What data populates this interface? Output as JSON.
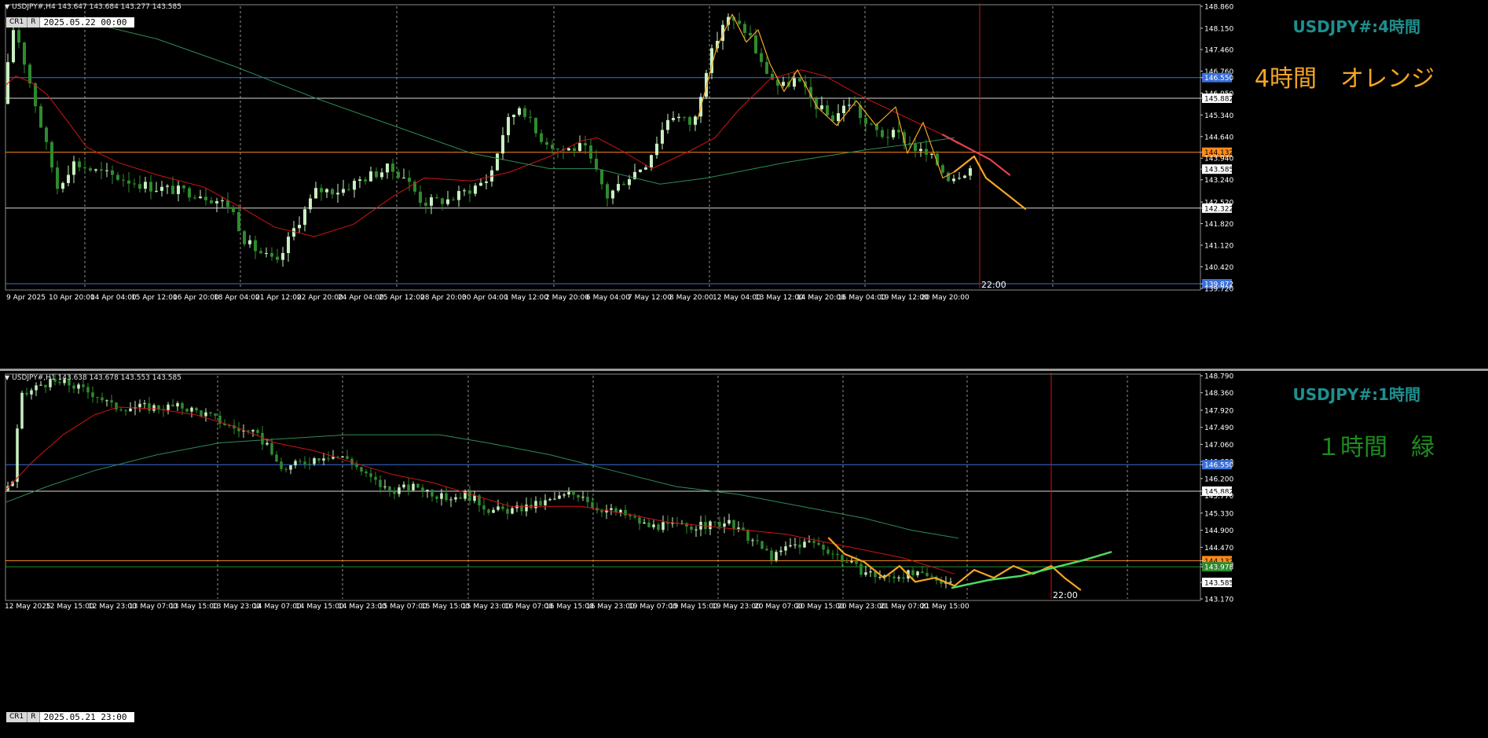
{
  "colors": {
    "background": "#000000",
    "bull": "#c8f0c0",
    "bear": "#2e8b2e",
    "ma_red": "#d01414",
    "ma_green": "#2e8b57",
    "zigzag_orange": "#f5a623",
    "h1_green_line": "#4cd964",
    "grid": "#b4b4b4",
    "hline_blue": "#3a6fd8",
    "hline_white": "#d8d8d8",
    "hline_orange": "#ff8c1a",
    "hline_green": "#2e8b2e",
    "vline_red": "#c81414",
    "title_teal": "#1e8f8f",
    "label_orange": "#f5a623",
    "label_green": "#1e8c1e"
  },
  "h4": {
    "header": "USDJPY#,H4  143.647 143.684 143.277 143.585",
    "period_buttons": [
      "CR1",
      "R"
    ],
    "date_box": "2025.05.22 00:00",
    "chart_title": "USDJPY#:4時間",
    "color_label": "4時間　オレンジ",
    "time_marker": "22:00",
    "price_labels": [
      {
        "text": "148.860",
        "kind": "plain"
      },
      {
        "text": "148.150",
        "kind": "plain"
      },
      {
        "text": "147.460",
        "kind": "plain"
      },
      {
        "text": "146.760",
        "kind": "plain"
      },
      {
        "text": "146.550",
        "kind": "blue"
      },
      {
        "text": "146.050",
        "kind": "plain"
      },
      {
        "text": "145.882",
        "kind": "white"
      },
      {
        "text": "145.340",
        "kind": "plain"
      },
      {
        "text": "144.640",
        "kind": "plain"
      },
      {
        "text": "144.132",
        "kind": "orange"
      },
      {
        "text": "143.940",
        "kind": "plain"
      },
      {
        "text": "143.585",
        "kind": "white"
      },
      {
        "text": "143.240",
        "kind": "plain"
      },
      {
        "text": "142.520",
        "kind": "plain"
      },
      {
        "text": "142.322",
        "kind": "white"
      },
      {
        "text": "141.820",
        "kind": "plain"
      },
      {
        "text": "141.120",
        "kind": "plain"
      },
      {
        "text": "140.420",
        "kind": "plain"
      },
      {
        "text": "139.872",
        "kind": "blue"
      },
      {
        "text": "139.720",
        "kind": "plain"
      }
    ],
    "time_labels": [
      "9 Apr 2025",
      "10 Apr 20:00",
      "14 Apr 04:00",
      "15 Apr 12:00",
      "16 Apr 20:00",
      "18 Apr 04:00",
      "21 Apr 12:00",
      "22 Apr 20:00",
      "24 Apr 04:00",
      "25 Apr 12:00",
      "28 Apr 20:00",
      "30 Apr 04:00",
      "1 May 12:00",
      "2 May 20:00",
      "6 May 04:00",
      "7 May 12:00",
      "8 May 20:00",
      "12 May 04:00",
      "13 May 12:00",
      "14 May 20:00",
      "16 May 04:00",
      "19 May 12:00",
      "20 May 20:00"
    ]
  },
  "h1": {
    "header": "USDJPY#,H1  143.638 143.678 143.553 143.585",
    "period_buttons": [
      "CR1",
      "R"
    ],
    "date_box": "2025.05.21 23:00",
    "chart_title": "USDJPY#:1時間",
    "color_label": "１時間　緑",
    "time_marker": "22:00",
    "price_labels": [
      {
        "text": "148.790",
        "kind": "plain"
      },
      {
        "text": "148.360",
        "kind": "plain"
      },
      {
        "text": "147.920",
        "kind": "plain"
      },
      {
        "text": "147.490",
        "kind": "plain"
      },
      {
        "text": "147.060",
        "kind": "plain"
      },
      {
        "text": "146.630",
        "kind": "plain"
      },
      {
        "text": "146.550",
        "kind": "blue"
      },
      {
        "text": "146.200",
        "kind": "plain"
      },
      {
        "text": "145.882",
        "kind": "white"
      },
      {
        "text": "145.770",
        "kind": "plain"
      },
      {
        "text": "145.330",
        "kind": "plain"
      },
      {
        "text": "144.900",
        "kind": "plain"
      },
      {
        "text": "144.470",
        "kind": "plain"
      },
      {
        "text": "144.132",
        "kind": "orange"
      },
      {
        "text": "144.040",
        "kind": "plain"
      },
      {
        "text": "143.978",
        "kind": "green"
      },
      {
        "text": "143.585",
        "kind": "white"
      },
      {
        "text": "143.170",
        "kind": "plain"
      }
    ],
    "time_labels": [
      "12 May 2025",
      "12 May 15:00",
      "12 May 23:00",
      "13 May 07:00",
      "13 May 15:00",
      "13 May 23:00",
      "14 May 07:00",
      "14 May 15:00",
      "14 May 23:00",
      "15 May 07:00",
      "15 May 15:00",
      "15 May 23:00",
      "16 May 07:00",
      "16 May 15:00",
      "16 May 23:00",
      "19 May 07:00",
      "19 May 15:00",
      "19 May 23:00",
      "20 May 07:00",
      "20 May 15:00",
      "20 May 23:00",
      "21 May 07:00",
      "21 May 15:00"
    ]
  },
  "chart_data": [
    {
      "type": "line",
      "title": "USDJPY#:4時間",
      "ylim": [
        139.72,
        148.86
      ],
      "horizontal_levels": [
        146.55,
        145.882,
        144.132,
        142.322,
        139.872
      ],
      "x": [
        "9 Apr 2025",
        "10 Apr 20:00",
        "14 Apr 04:00",
        "15 Apr 12:00",
        "16 Apr 20:00",
        "18 Apr 04:00",
        "21 Apr 12:00",
        "22 Apr 20:00",
        "24 Apr 04:00",
        "25 Apr 12:00",
        "28 Apr 20:00",
        "30 Apr 04:00",
        "1 May 12:00",
        "2 May 20:00",
        "6 May 04:00",
        "7 May 12:00",
        "8 May 20:00",
        "12 May 04:00",
        "13 May 12:00",
        "14 May 20:00",
        "16 May 04:00",
        "19 May 12:00",
        "20 May 20:00"
      ],
      "series": [
        {
          "values": [
            146.0,
            144.8,
            144.2,
            143.5,
            143.2,
            142.7,
            140.6,
            142.4,
            142.8,
            143.6,
            142.6,
            143.0,
            145.6,
            144.2,
            142.8,
            143.6,
            145.3,
            147.8,
            146.7,
            145.7,
            145.3,
            144.7,
            143.6
          ]
        }
      ]
    },
    {
      "type": "line",
      "title": "USDJPY#:1時間",
      "ylim": [
        143.17,
        148.79
      ],
      "horizontal_levels": [
        146.55,
        145.882,
        144.132,
        143.978
      ],
      "x": [
        "12 May 2025",
        "12 May 15:00",
        "12 May 23:00",
        "13 May 07:00",
        "13 May 15:00",
        "13 May 23:00",
        "14 May 07:00",
        "14 May 15:00",
        "14 May 23:00",
        "15 May 07:00",
        "15 May 15:00",
        "15 May 23:00",
        "16 May 07:00",
        "16 May 15:00",
        "16 May 23:00",
        "19 May 07:00",
        "19 May 15:00",
        "19 May 23:00",
        "20 May 07:00",
        "20 May 15:00",
        "20 May 23:00",
        "21 May 07:00",
        "21 May 15:00"
      ],
      "series": [
        {
          "values": [
            146.0,
            148.3,
            147.9,
            147.9,
            147.5,
            147.2,
            146.6,
            146.6,
            146.3,
            146.0,
            145.7,
            145.4,
            145.5,
            145.9,
            145.2,
            144.9,
            145.0,
            144.9,
            144.6,
            144.8,
            144.2,
            143.9,
            143.7
          ]
        }
      ]
    }
  ]
}
